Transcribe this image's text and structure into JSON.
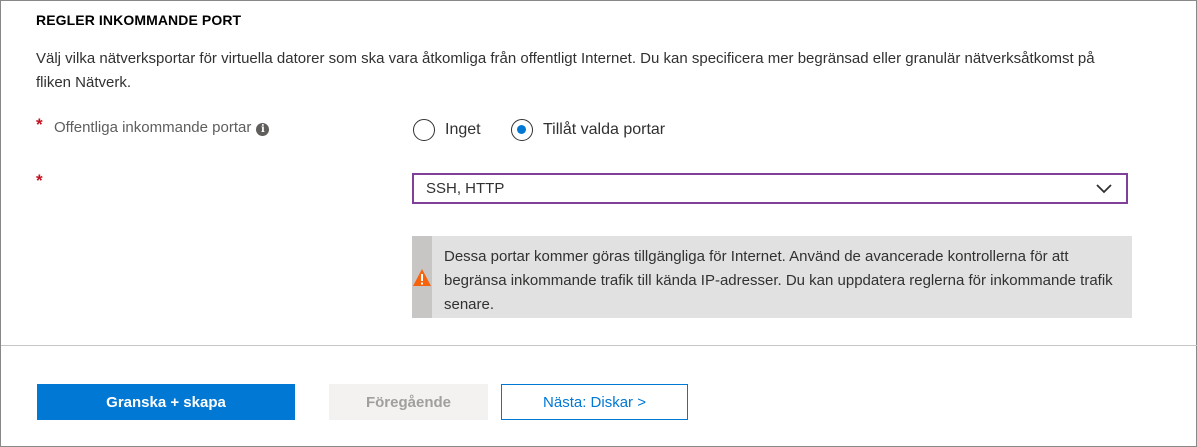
{
  "section": {
    "title": "REGLER INKOMMANDE PORT",
    "description": "Välj vilka nätverksportar för virtuella datorer som ska vara åtkomliga från offentligt Internet. Du kan specificera mer begränsad eller granulär nätverksåtkomst på fliken Nätverk."
  },
  "public_ports": {
    "required_marker": "*",
    "label": "Offentliga inkommande portar",
    "info_icon": "info-icon",
    "options": [
      {
        "label": "Inget",
        "selected": false
      },
      {
        "label": "Tillåt valda portar",
        "selected": true
      }
    ]
  },
  "ports_select": {
    "required_marker": "*",
    "value": "SSH, HTTP",
    "icon": "chevron-down-icon"
  },
  "warning": {
    "icon": "warning-icon",
    "text": "Dessa portar kommer göras tillgängliga för Internet. Använd de avancerade kontrollerna för att begränsa inkommande trafik till kända IP-adresser. Du kan uppdatera reglerna för inkommande trafik senare."
  },
  "footer": {
    "review_create": "Granska + skapa",
    "previous": "Föregående",
    "next": "Nästa: Diskar >"
  },
  "colors": {
    "accent": "#0078d4",
    "required": "#c50f1f",
    "select_border": "#80409a",
    "warning_icon": "#f7630c"
  }
}
